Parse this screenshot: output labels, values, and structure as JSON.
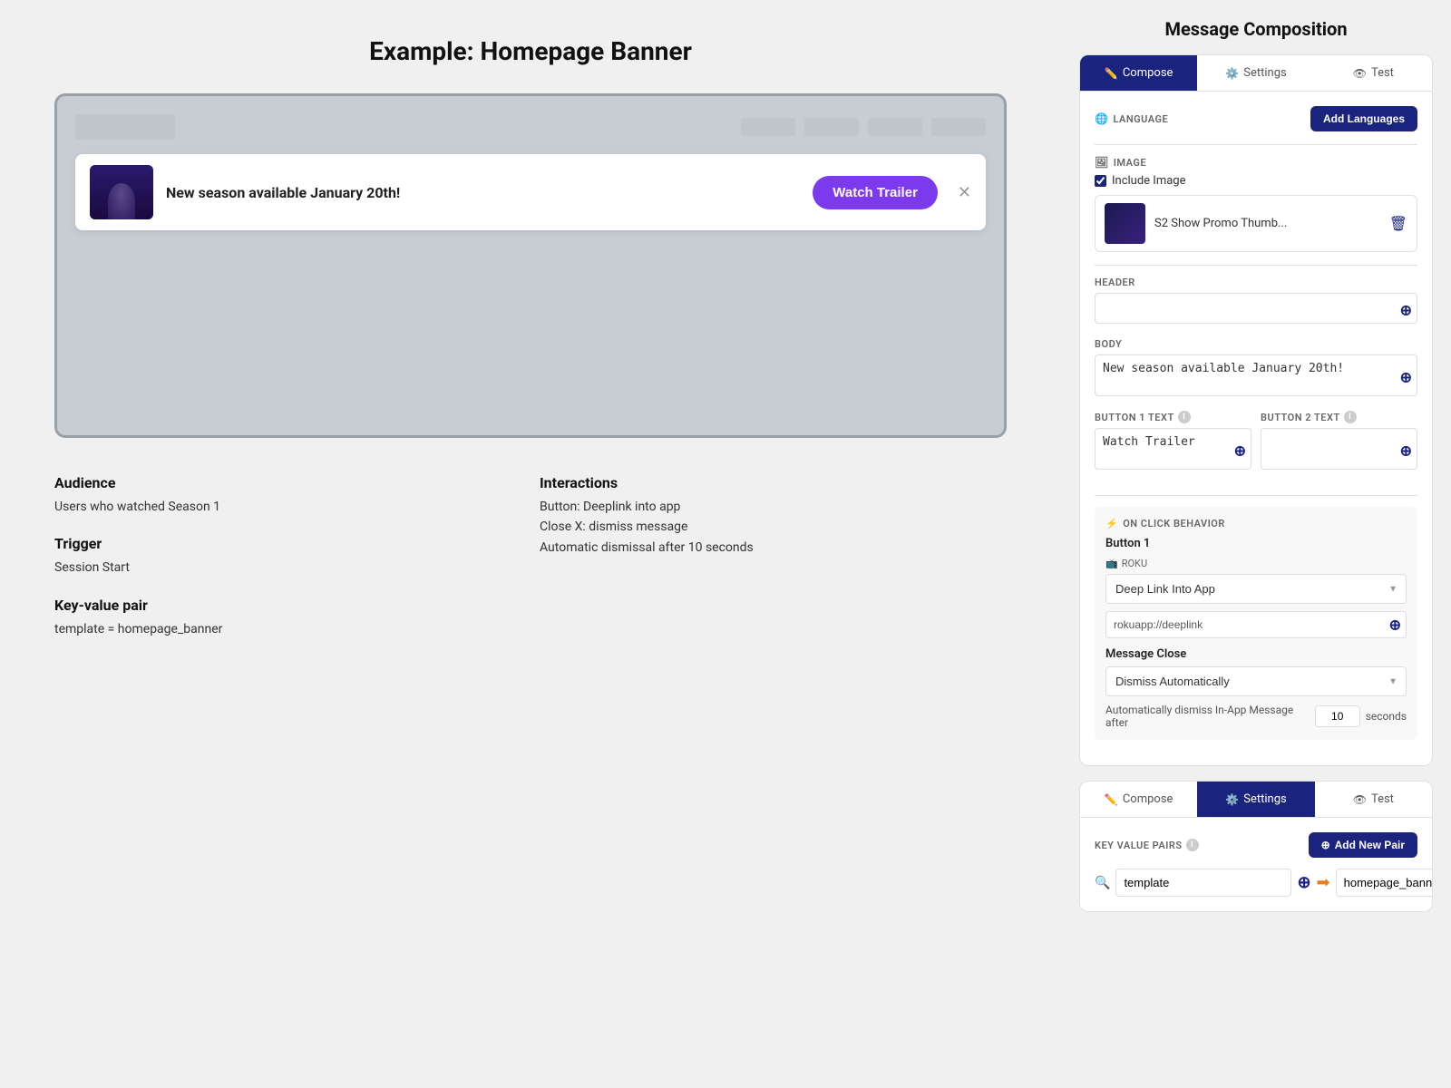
{
  "left": {
    "title": "Example: Homepage Banner",
    "banner": {
      "text": "New season available January 20th!",
      "cta": "Watch Trailer",
      "close_symbol": "✕"
    },
    "metadata": {
      "audience_label": "Audience",
      "audience_value": "Users who watched Season 1",
      "trigger_label": "Trigger",
      "trigger_value": "Session Start",
      "kv_label": "Key-value pair",
      "kv_value": "template = homepage_banner",
      "interactions_label": "Interactions",
      "interaction_1": "Button: Deeplink into app",
      "interaction_2": "Close X: dismiss message",
      "interaction_3": "Automatic dismissal after 10 seconds"
    }
  },
  "right": {
    "title": "Message Composition",
    "card1": {
      "tabs": [
        {
          "id": "compose",
          "label": "Compose",
          "icon": "✏️",
          "active": true
        },
        {
          "id": "settings",
          "label": "Settings",
          "icon": "⚙️",
          "active": false
        },
        {
          "id": "test",
          "label": "Test",
          "icon": "👁",
          "active": false
        }
      ],
      "language_label": "LANGUAGE",
      "add_lang_btn": "Add Languages",
      "image_label": "IMAGE",
      "include_image_label": "Include Image",
      "image_name": "S2 Show Promo Thumb...",
      "header_label": "HEADER",
      "header_value": "",
      "body_label": "BODY",
      "body_value": "New season available January 20th!",
      "button1_label": "BUTTON 1 TEXT",
      "button1_value": "Watch Trailer",
      "button2_label": "BUTTON 2 TEXT",
      "button2_value": "",
      "on_click_label": "ON CLICK BEHAVIOR",
      "on_click_icon": "⚡",
      "button1_behavior_label": "Button 1",
      "roku_label": "ROKU",
      "roku_icon": "📺",
      "deep_link_option": "Deep Link Into App",
      "roku_url": "rokuapp://deeplink",
      "message_close_label": "Message Close",
      "dismiss_option": "Dismiss Automatically",
      "auto_dismiss_text": "Automatically dismiss In-App Message after",
      "auto_dismiss_seconds": "10",
      "seconds_label": "seconds"
    },
    "card2": {
      "tabs": [
        {
          "id": "compose",
          "label": "Compose",
          "icon": "✏️",
          "active": false
        },
        {
          "id": "settings",
          "label": "Settings",
          "icon": "⚙️",
          "active": true
        },
        {
          "id": "test",
          "label": "Test",
          "icon": "👁",
          "active": false
        }
      ],
      "kv_label": "KEY VALUE PAIRS",
      "add_pair_btn": "Add New Pair",
      "kv_key": "template",
      "kv_value": "homepage_banner"
    }
  }
}
